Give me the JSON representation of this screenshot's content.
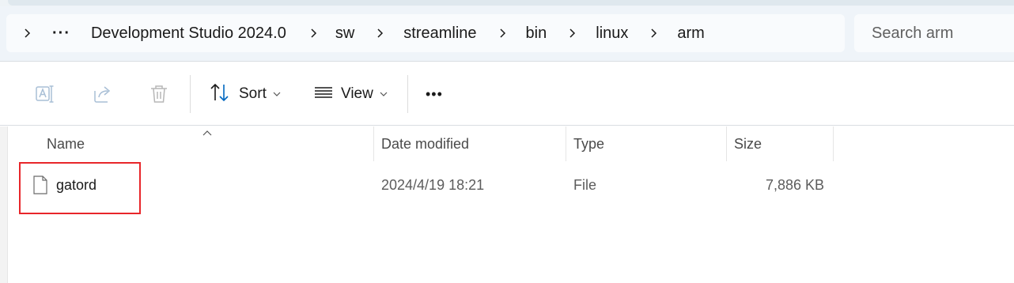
{
  "breadcrumb": {
    "overflow_label": "···",
    "items": [
      "Development Studio 2024.0",
      "sw",
      "streamline",
      "bin",
      "linux",
      "arm"
    ]
  },
  "search": {
    "placeholder": "Search arm"
  },
  "toolbar": {
    "rename_icon": "rename-icon",
    "share_icon": "share-icon",
    "delete_icon": "trash-icon",
    "sort_label": "Sort",
    "view_label": "View",
    "more_label": "•••"
  },
  "columns": {
    "name": "Name",
    "date_modified": "Date modified",
    "type": "Type",
    "size": "Size"
  },
  "files": [
    {
      "name": "gatord",
      "date_modified": "2024/4/19 18:21",
      "type": "File",
      "size": "7,886 KB"
    }
  ],
  "colors": {
    "accent": "#0067c0",
    "highlight": "#e8262a",
    "address_bg": "#eff4f9"
  }
}
